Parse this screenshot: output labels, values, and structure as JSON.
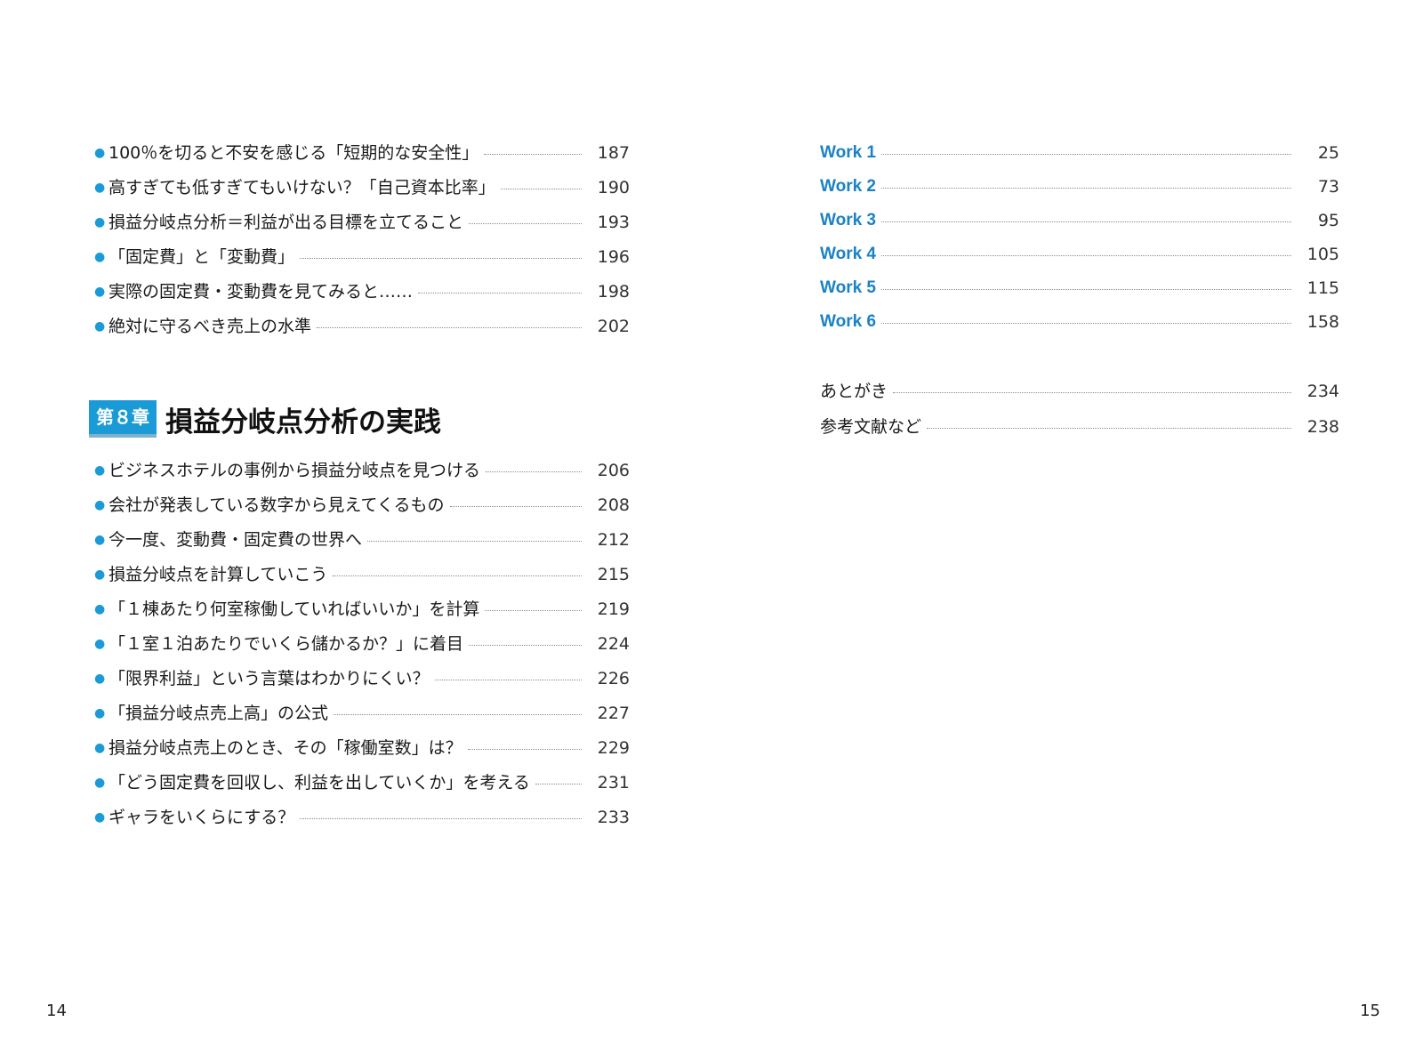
{
  "left_entries_top": [
    {
      "title": "100％を切ると不安を感じる「短期的な安全性」",
      "page": "187"
    },
    {
      "title": "高すぎても低すぎてもいけない？「自己資本比率」",
      "page": "190"
    },
    {
      "title": "損益分岐点分析＝利益が出る目標を立てること",
      "page": "193"
    },
    {
      "title": "「固定費」と「変動費」",
      "page": "196"
    },
    {
      "title": "実際の固定費・変動費を見てみると……",
      "page": "198"
    },
    {
      "title": "絶対に守るべき売上の水準",
      "page": "202"
    }
  ],
  "chapter8": {
    "badge": "第８章",
    "title": "損益分岐点分析の実践",
    "entries": [
      {
        "title": "ビジネスホテルの事例から損益分岐点を見つける",
        "page": "206"
      },
      {
        "title": "会社が発表している数字から見えてくるもの",
        "page": "208"
      },
      {
        "title": "今一度、変動費・固定費の世界へ",
        "page": "212"
      },
      {
        "title": "損益分岐点を計算していこう",
        "page": "215"
      },
      {
        "title": "「１棟あたり何室稼働していればいいか」を計算",
        "page": "219"
      },
      {
        "title": "「１室１泊あたりでいくら儲かるか？」に着目",
        "page": "224"
      },
      {
        "title": "「限界利益」という言葉はわかりにくい？",
        "page": "226"
      },
      {
        "title": "「損益分岐点売上高」の公式",
        "page": "227"
      },
      {
        "title": "損益分岐点売上のとき、その「稼働室数」は？",
        "page": "229"
      },
      {
        "title": "「どう固定費を回収し、利益を出していくか」を考える",
        "page": "231"
      },
      {
        "title": "ギャラをいくらにする？",
        "page": "233"
      }
    ]
  },
  "works": [
    {
      "title": "Work 1",
      "page": "25"
    },
    {
      "title": "Work 2",
      "page": "73"
    },
    {
      "title": "Work 3",
      "page": "95"
    },
    {
      "title": "Work 4",
      "page": "105"
    },
    {
      "title": "Work 5",
      "page": "115"
    },
    {
      "title": "Work 6",
      "page": "158"
    }
  ],
  "back_matter": [
    {
      "title": "あとがき",
      "page": "234"
    },
    {
      "title": "参考文献など",
      "page": "238"
    }
  ],
  "folio_left": "14",
  "folio_right": "15",
  "colors": {
    "accent": "#1a9bd7",
    "work_label": "#1a82c4"
  }
}
